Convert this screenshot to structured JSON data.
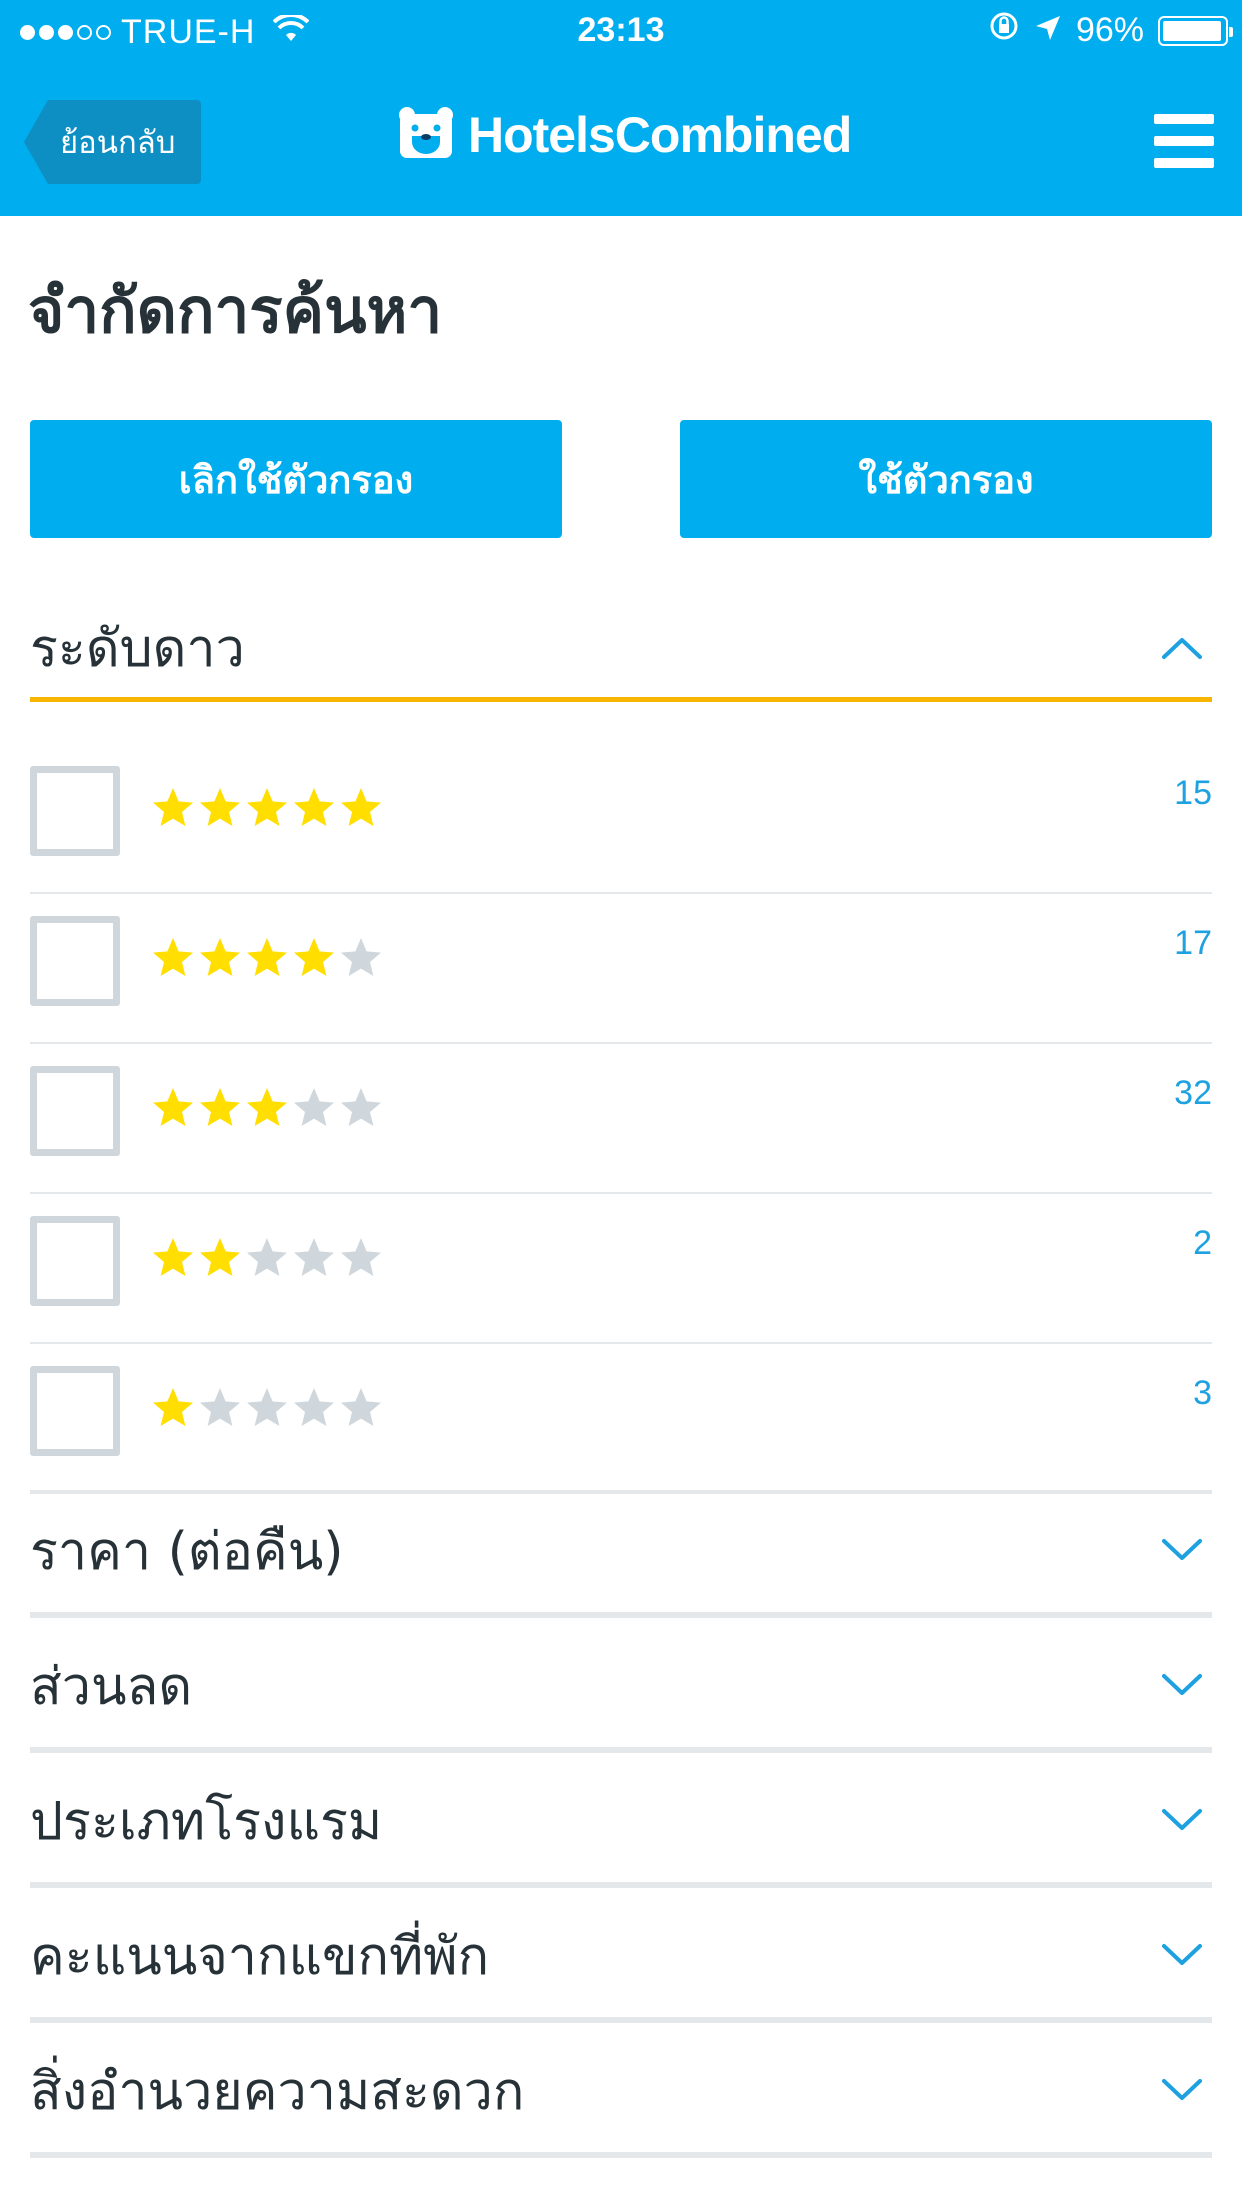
{
  "status_bar": {
    "carrier": "TRUE-H",
    "time": "23:13",
    "battery": "96%"
  },
  "nav": {
    "back_label": "ย้อนกลับ",
    "logo_text": "HotelsCombined"
  },
  "page": {
    "title": "จำกัดการค้นหา"
  },
  "buttons": {
    "clear_label": "เลิกใช้ตัวกรอง",
    "apply_label": "ใช้ตัวกรอง"
  },
  "star_rating": {
    "label": "ระดับดาว",
    "expanded": true,
    "rows": [
      {
        "stars": 5,
        "count": "15"
      },
      {
        "stars": 4,
        "count": "17"
      },
      {
        "stars": 3,
        "count": "32"
      },
      {
        "stars": 2,
        "count": "2"
      },
      {
        "stars": 1,
        "count": "3"
      }
    ]
  },
  "sections": [
    {
      "label": "ราคา (ต่อคืน)"
    },
    {
      "label": "ส่วนลด"
    },
    {
      "label": "ประเภทโรงแรม"
    },
    {
      "label": "คะแนนจากแขกที่พัก"
    },
    {
      "label": "สิ่งอำนวยความสะดวก"
    }
  ],
  "colors": {
    "brand": "#00adee",
    "star_filled": "#ffde00",
    "star_empty": "#cfd7dc",
    "section_accent": "#f7b500",
    "count_text": "#1ea1e0"
  }
}
